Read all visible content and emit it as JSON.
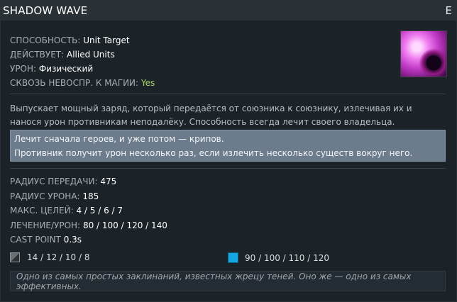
{
  "header": {
    "title": "SHADOW WAVE",
    "hotkey": "E"
  },
  "ability_stats": [
    {
      "label": "СПОСОБНОСТЬ:",
      "value": "Unit Target"
    },
    {
      "label": "ДЕЙСТВУЕТ:",
      "value": "Allied Units"
    },
    {
      "label": "УРОН:",
      "value": "Физический"
    },
    {
      "label": "СКВОЗЬ НЕВОСПР. К МАГИИ:",
      "value": "Yes"
    }
  ],
  "icon": {
    "name": "shadow-wave-ability-icon"
  },
  "description": "Выпускает мощный заряд, который передаётся от союзника к союзнику, излечивая их и нанося урон противникам неподалёку. Способность всегда лечит своего владельца.",
  "note": {
    "line1": "Лечит сначала героев, и уже потом — крипов.",
    "line2": "Противник получит урон несколько раз, если излечить несколько существ вокруг него."
  },
  "values": [
    {
      "label": "РАДИУС ПЕРЕДАЧИ:",
      "value": "475"
    },
    {
      "label": "РАДИУС УРОНА:",
      "value": "185"
    },
    {
      "label": "МАКС. ЦЕЛЕЙ:",
      "value": "4 / 5 / 6 / 7"
    },
    {
      "label": "ЛЕЧЕНИЕ/УРОН:",
      "value": "80 / 100 / 120 / 140"
    },
    {
      "label": "CAST POINT",
      "value": "0.3s"
    }
  ],
  "costs": {
    "cooldown": "14 / 12 / 10 / 8",
    "mana": "90 / 100 / 110 / 120"
  },
  "lore": "Одно из самых простых заклинаний, известных жрецу теней. Оно же — одно из самых эффективных.",
  "colors": {
    "background": "#1c2328",
    "header": "#2a3136",
    "note_bg": "#6c7c8d",
    "yes_green": "#a7d16a",
    "mana_blue": "#14a6e0"
  }
}
